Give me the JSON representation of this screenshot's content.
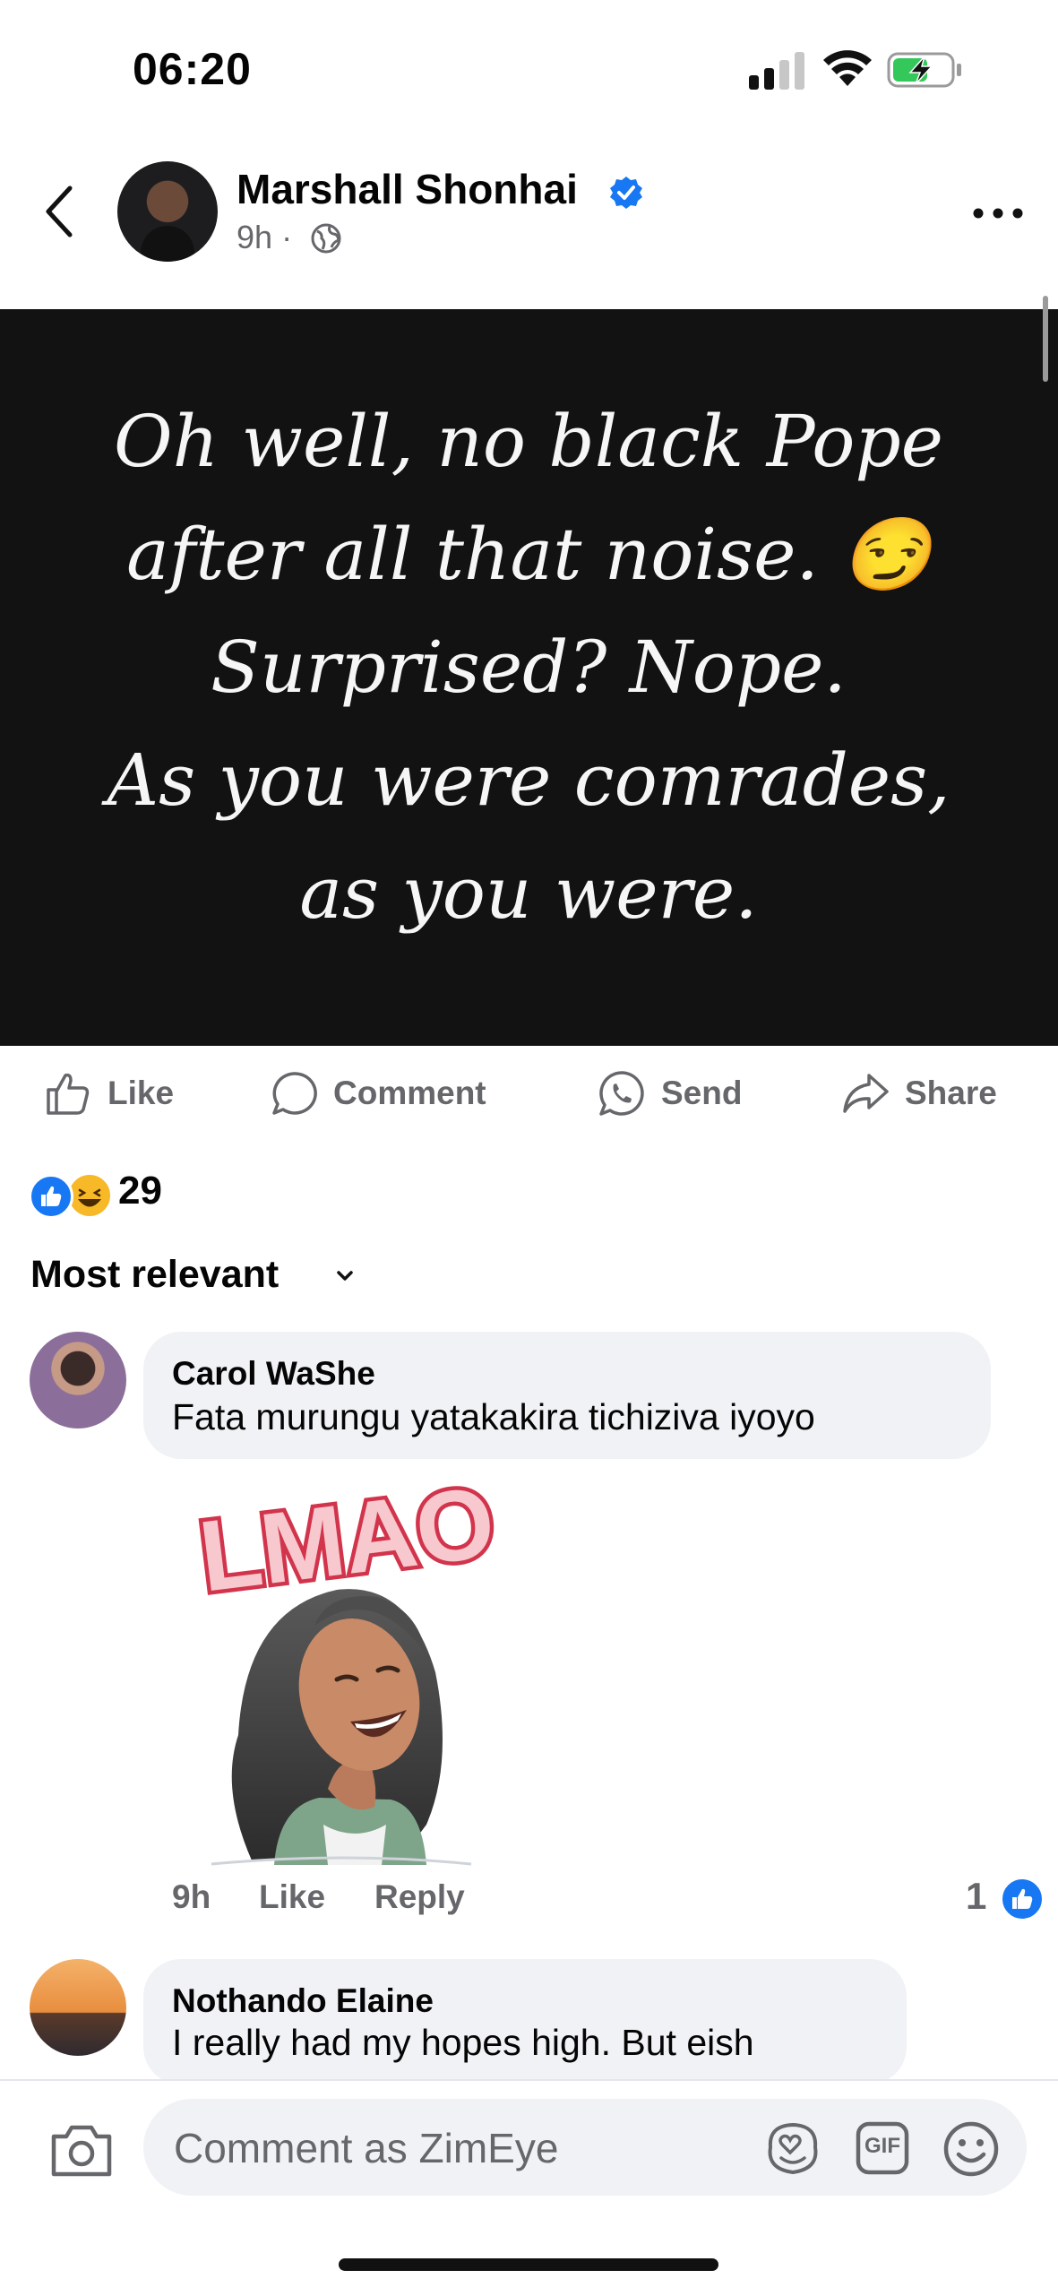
{
  "status": {
    "time": "06:20"
  },
  "post": {
    "author": "Marshall Shonhai",
    "time": "9h",
    "separator": "·",
    "quote_lines": [
      "Oh well, no black Pope",
      "after all that noise. 😏",
      "Surprised? Nope.",
      "As you were comrades,",
      "as you were."
    ]
  },
  "actions": {
    "like": "Like",
    "comment": "Comment",
    "send": "Send",
    "share": "Share"
  },
  "reactions": {
    "count": "29"
  },
  "sort": {
    "label": "Most relevant"
  },
  "comments": [
    {
      "name": "Carol WaShe",
      "text": "Fata murungu yatakakira tichiziva iyoyo",
      "sticker_text": "LMAO",
      "time": "9h",
      "like_label": "Like",
      "reply_label": "Reply",
      "like_count": "1"
    },
    {
      "name": "Nothando Elaine",
      "text": "I really had my hopes high. But eish"
    }
  ],
  "composer": {
    "placeholder": "Comment as ZimEye",
    "gif_label": "GIF"
  },
  "icons": {
    "back": "chevron-left-icon",
    "verified": "verified-badge-icon",
    "audience": "globe-icon",
    "more": "ellipsis-icon",
    "like": "thumbs-up-icon",
    "comment": "speech-bubble-icon",
    "send": "whatsapp-icon",
    "share": "share-arrow-icon",
    "camera": "camera-icon",
    "avatar_sticker": "avatar-sticker-icon",
    "gif": "gif-icon",
    "emoji": "emoji-icon"
  },
  "colors": {
    "accent": "#1877f2",
    "haha": "#f7b928",
    "muted": "#65676b",
    "bubble": "#f0f2f5",
    "quote_bg": "#121212"
  }
}
